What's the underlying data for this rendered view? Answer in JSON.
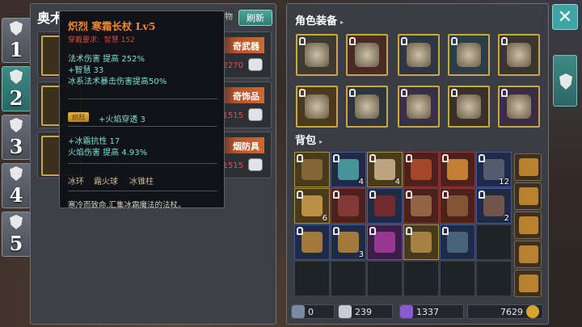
{
  "tabs": [
    {
      "num": "1"
    },
    {
      "num": "2"
    },
    {
      "num": "3"
    },
    {
      "num": "4"
    },
    {
      "num": "5"
    }
  ],
  "left": {
    "title": "奥术",
    "tag": "物",
    "refresh": "刷新",
    "items": [
      {
        "name": "奇武器",
        "price": "2270"
      },
      {
        "name": "奇饰品",
        "price": "1515"
      },
      {
        "name": "烟防具",
        "price": "1515"
      }
    ]
  },
  "tooltip": {
    "name": "炽烈  寒霜长杖  Lv5",
    "req_label": "穿戴要求:",
    "req_value": "智慧 152",
    "stats": [
      "法术伤害 提高 252%",
      "+智慧 33",
      "冰系法术暴击伤害提高50%"
    ],
    "badge": "炽烈",
    "badge_stat": "+火焰穿透 3",
    "extra": [
      "+冰霜抗性 17",
      "火焰伤害 提高 4.93%"
    ],
    "skills": [
      "冰环",
      "霜火球",
      "冰锥柱"
    ],
    "flavor": "寒冷而致命,汇集冰霜魔法的法杖。"
  },
  "right": {
    "equip_title": "角色装备",
    "bag_title": "背包",
    "equip_colors": [
      "#3b3a33",
      "#4a2a24",
      "#2e3544",
      "#2c3d4a",
      "#393530",
      "#4a3820",
      "#2e3540",
      "#38304a",
      "#3a2f2a",
      "#3a2c44"
    ],
    "equip_icons": [
      "helmet-icon",
      "chest-armor-icon",
      "armor-icon",
      "ring-icon",
      "sword-icon",
      "amulet-icon",
      "gauntlet-icon",
      "boots-icon",
      "ring-icon",
      "shoulder-icon"
    ],
    "bag": [
      {
        "cls": "c-gold",
        "count": "",
        "color": "#8a6a3a"
      },
      {
        "cls": "c-blue",
        "count": "4",
        "color": "#4aa0a0"
      },
      {
        "cls": "c-gold",
        "count": "4",
        "color": "#c8b08a"
      },
      {
        "cls": "c-red",
        "count": "",
        "color": "#b04a2a"
      },
      {
        "cls": "c-red",
        "count": "",
        "color": "#d08a3a"
      },
      {
        "cls": "c-blue",
        "count": "12",
        "color": "#5a6070"
      },
      {
        "cls": "c-gold",
        "count": "6",
        "color": "#c89a4a"
      },
      {
        "cls": "c-red",
        "count": "",
        "color": "#8a3a3a"
      },
      {
        "cls": "c-blue",
        "count": "",
        "color": "#7a2a2a"
      },
      {
        "cls": "c-red",
        "count": "",
        "color": "#9a6a4a"
      },
      {
        "cls": "c-red",
        "count": "",
        "color": "#8a5a3a"
      },
      {
        "cls": "c-blue",
        "count": "2",
        "color": "#7a5a4a"
      },
      {
        "cls": "c-blue",
        "count": "",
        "color": "#b0823a"
      },
      {
        "cls": "c-blue",
        "count": "3",
        "color": "#b0823a"
      },
      {
        "cls": "c-purp",
        "count": "",
        "color": "#a03a9a"
      },
      {
        "cls": "c-gold",
        "count": "",
        "color": "#b08a4a"
      },
      {
        "cls": "c-blue",
        "count": "",
        "color": "#4a6a7a"
      },
      {
        "cls": "",
        "count": "",
        "color": ""
      },
      {
        "cls": "",
        "count": "",
        "color": ""
      },
      {
        "cls": "",
        "count": "",
        "color": ""
      },
      {
        "cls": "",
        "count": "",
        "color": ""
      },
      {
        "cls": "",
        "count": "",
        "color": ""
      },
      {
        "cls": "",
        "count": "",
        "color": ""
      },
      {
        "cls": "",
        "count": "",
        "color": ""
      }
    ],
    "currency": {
      "gear": "0",
      "mana": "239",
      "gem": "1337",
      "gold": "7629"
    }
  }
}
